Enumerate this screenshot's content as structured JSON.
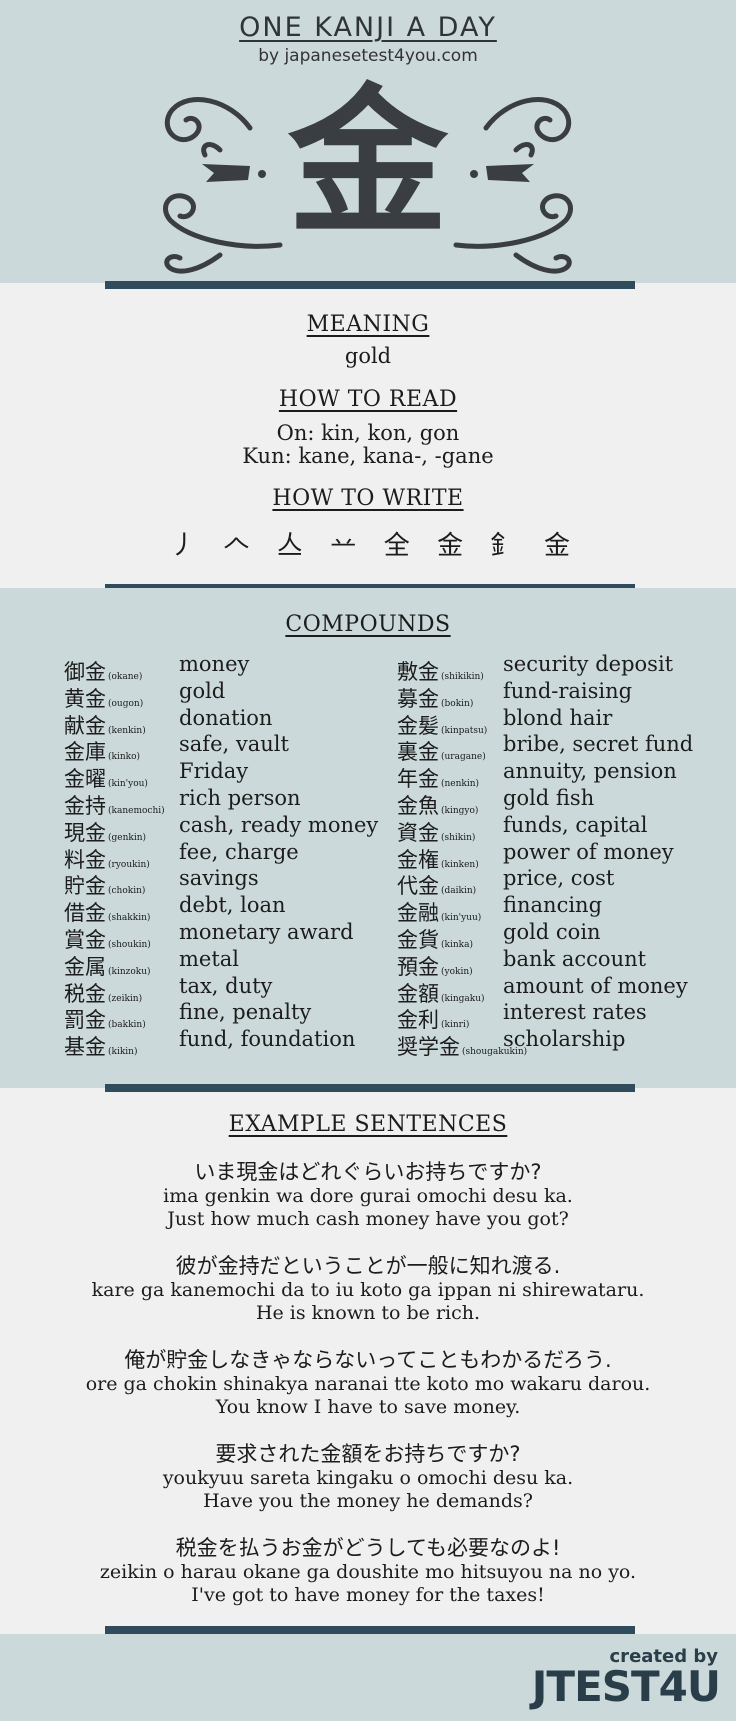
{
  "header": {
    "title": "ONE KANJI A DAY",
    "subtitle": "by japanesetest4you.com",
    "kanji": "金"
  },
  "meaning": {
    "title": "MEANING",
    "value": "gold"
  },
  "reading": {
    "title": "HOW TO READ",
    "on": "On: kin, kon, gon",
    "kun": "Kun: kane, kana-, -gane"
  },
  "writing": {
    "title": "HOW TO WRITE",
    "strokes": [
      "丿",
      "𠆢",
      "亼",
      "䒑",
      "全",
      "⾦",
      "釒",
      "金"
    ]
  },
  "compounds": {
    "title": "COMPOUNDS",
    "left": [
      {
        "k": "御金",
        "r": "(okane)",
        "m": "money"
      },
      {
        "k": "黄金",
        "r": "(ougon)",
        "m": "gold"
      },
      {
        "k": "献金",
        "r": "(kenkin)",
        "m": "donation"
      },
      {
        "k": "金庫",
        "r": "(kinko)",
        "m": "safe, vault"
      },
      {
        "k": "金曜",
        "r": "(kin'you)",
        "m": "Friday"
      },
      {
        "k": "金持",
        "r": "(kanemochi)",
        "m": "rich person"
      },
      {
        "k": "現金",
        "r": "(genkin)",
        "m": "cash, ready money"
      },
      {
        "k": "料金",
        "r": "(ryoukin)",
        "m": "fee, charge"
      },
      {
        "k": "貯金",
        "r": "(chokin)",
        "m": "savings"
      },
      {
        "k": "借金",
        "r": "(shakkin)",
        "m": "debt, loan"
      },
      {
        "k": "賞金",
        "r": "(shoukin)",
        "m": "monetary award"
      },
      {
        "k": "金属",
        "r": "(kinzoku)",
        "m": "metal"
      },
      {
        "k": "税金",
        "r": "(zeikin)",
        "m": "tax, duty"
      },
      {
        "k": "罰金",
        "r": "(bakkin)",
        "m": "fine, penalty"
      },
      {
        "k": "基金",
        "r": "(kikin)",
        "m": "fund, foundation"
      }
    ],
    "right": [
      {
        "k": "敷金",
        "r": "(shikikin)",
        "m": "security deposit"
      },
      {
        "k": "募金",
        "r": "(bokin)",
        "m": "fund-raising"
      },
      {
        "k": "金髪",
        "r": "(kinpatsu)",
        "m": "blond hair"
      },
      {
        "k": "裏金",
        "r": "(uragane)",
        "m": "bribe, secret fund"
      },
      {
        "k": "年金",
        "r": "(nenkin)",
        "m": "annuity, pension"
      },
      {
        "k": "金魚",
        "r": "(kingyo)",
        "m": "gold fish"
      },
      {
        "k": "資金",
        "r": "(shikin)",
        "m": "funds, capital"
      },
      {
        "k": "金権",
        "r": "(kinken)",
        "m": "power of money"
      },
      {
        "k": "代金",
        "r": "(daikin)",
        "m": "price, cost"
      },
      {
        "k": "金融",
        "r": "(kin'yuu)",
        "m": "financing"
      },
      {
        "k": "金貨",
        "r": "(kinka)",
        "m": "gold coin"
      },
      {
        "k": "預金",
        "r": "(yokin)",
        "m": "bank account"
      },
      {
        "k": "金額",
        "r": "(kingaku)",
        "m": "amount of money"
      },
      {
        "k": "金利",
        "r": "(kinri)",
        "m": "interest rates"
      },
      {
        "k": "奨学金",
        "r": "(shougakukin)",
        "m": "scholarship"
      }
    ]
  },
  "examples": {
    "title": "EXAMPLE SENTENCES",
    "items": [
      {
        "jp": "いま現金はどれぐらいお持ちですか?",
        "ro": "ima genkin wa dore gurai omochi desu ka.",
        "en": "Just how much cash money have you got?"
      },
      {
        "jp": "彼が金持だということが一般に知れ渡る.",
        "ro": "kare ga kanemochi da to iu koto ga ippan ni shirewataru.",
        "en": "He is known to be rich."
      },
      {
        "jp": "俺が貯金しなきゃならないってこともわかるだろう.",
        "ro": "ore ga chokin shinakya naranai tte koto mo wakaru darou.",
        "en": "You know I have to save money."
      },
      {
        "jp": "要求された金額をお持ちですか?",
        "ro": "youkyuu sareta kingaku o omochi desu ka.",
        "en": "Have you the money he demands?"
      },
      {
        "jp": "税金を払うお金がどうしても必要なのよ!",
        "ro": "zeikin o harau okane ga doushite mo hitsuyou na no yo.",
        "en": "I've got to have money for the taxes!"
      }
    ]
  },
  "footer": {
    "created_by": "created by",
    "brand": "JTEST4U"
  },
  "colors": {
    "band_blue": "#cbd9da",
    "band_grey": "#efefef",
    "rule": "#2f4b5c",
    "brand": "#2a3e4a"
  }
}
